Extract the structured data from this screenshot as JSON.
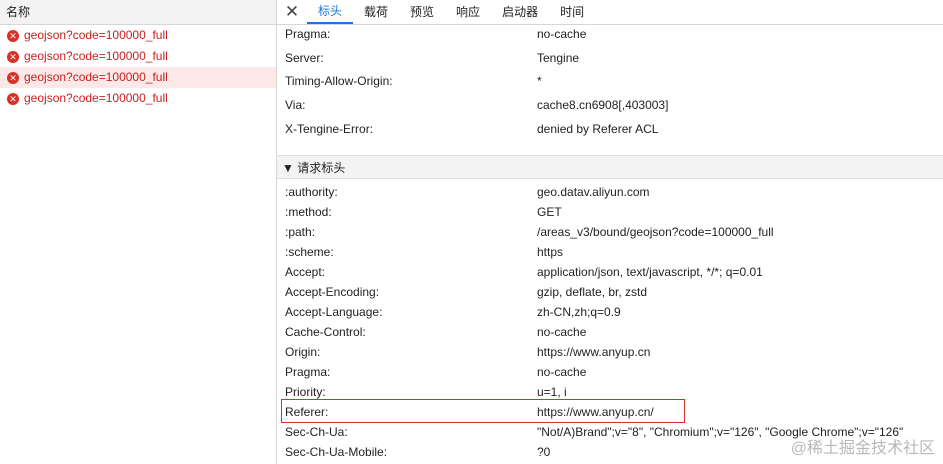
{
  "left_panel": {
    "header": "名称",
    "requests": [
      {
        "name": "geojson?code=100000_full"
      },
      {
        "name": "geojson?code=100000_full"
      },
      {
        "name": "geojson?code=100000_full"
      },
      {
        "name": "geojson?code=100000_full"
      }
    ]
  },
  "tabs": {
    "close_glyph": "✕",
    "items": [
      "标头",
      "载荷",
      "预览",
      "响应",
      "启动器",
      "时间"
    ]
  },
  "response_headers": [
    {
      "name": "Pragma:",
      "value": "no-cache"
    },
    {
      "name": "Server:",
      "value": "Tengine"
    },
    {
      "name": "Timing-Allow-Origin:",
      "value": "*"
    },
    {
      "name": "Via:",
      "value": "cache8.cn6908[,403003]"
    },
    {
      "name": "X-Tengine-Error:",
      "value": "denied by Referer ACL"
    }
  ],
  "request_section": {
    "title": "▼ 请求标头",
    "headers": [
      {
        "name": ":authority:",
        "value": "geo.datav.aliyun.com"
      },
      {
        "name": ":method:",
        "value": "GET"
      },
      {
        "name": ":path:",
        "value": "/areas_v3/bound/geojson?code=100000_full"
      },
      {
        "name": ":scheme:",
        "value": "https"
      },
      {
        "name": "Accept:",
        "value": "application/json, text/javascript, */*; q=0.01"
      },
      {
        "name": "Accept-Encoding:",
        "value": "gzip, deflate, br, zstd"
      },
      {
        "name": "Accept-Language:",
        "value": "zh-CN,zh;q=0.9"
      },
      {
        "name": "Cache-Control:",
        "value": "no-cache"
      },
      {
        "name": "Origin:",
        "value": "https://www.anyup.cn"
      },
      {
        "name": "Pragma:",
        "value": "no-cache"
      },
      {
        "name": "Priority:",
        "value": "u=1, i"
      },
      {
        "name": "Referer:",
        "value": "https://www.anyup.cn/"
      },
      {
        "name": "Sec-Ch-Ua:",
        "value": "\"Not/A)Brand\";v=\"8\", \"Chromium\";v=\"126\", \"Google Chrome\";v=\"126\""
      },
      {
        "name": "Sec-Ch-Ua-Mobile:",
        "value": "?0"
      }
    ]
  },
  "watermark": "@稀土掘金技术社区",
  "colors": {
    "error_red": "#c5221f",
    "selected_row": "#fce8e6",
    "accent_blue": "#1a73e8",
    "highlight_border": "#d93025"
  }
}
